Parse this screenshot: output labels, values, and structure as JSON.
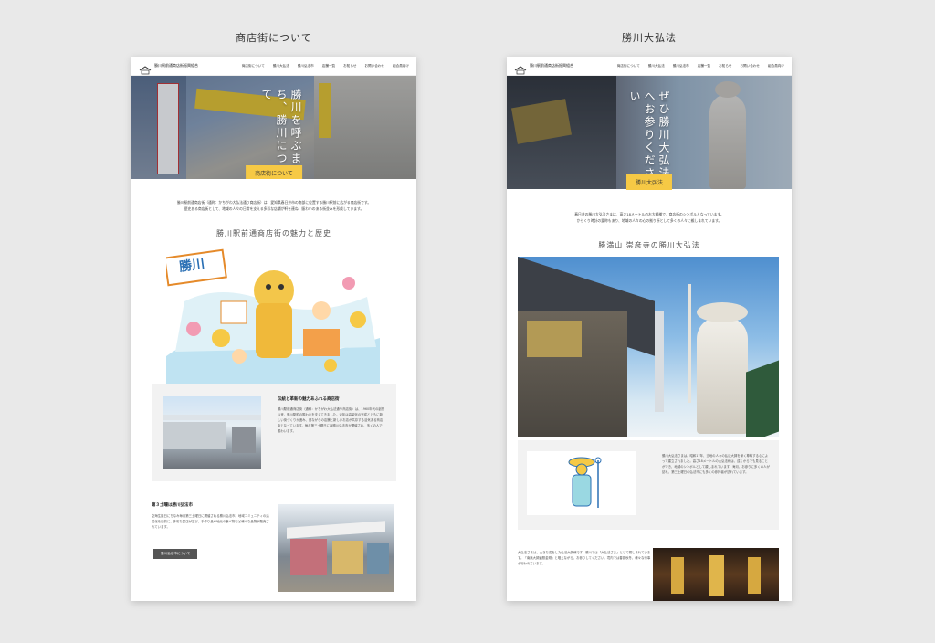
{
  "panels": {
    "left_title": "商店街について",
    "right_title": "勝川大弘法"
  },
  "left": {
    "header": {
      "logo_text": "勝川駅前通商店街振興組合",
      "nav": [
        "商店街について",
        "勝川大弘法",
        "勝川弘法市",
        "店舗一覧",
        "お知らせ",
        "お問い合わせ",
        "組合員向け"
      ]
    },
    "hero": {
      "vertical_text": "勝川を呼ぶまち、勝川について",
      "label": "商店街について",
      "sign_text": "勝川"
    },
    "intro": [
      "勝川駅前通商店街（通称：かちがわ大弘法通り商店街）は、愛知県春日井市の南部に位置する勝川駅前に広がる商店街です。",
      "歴史ある商店街として、地域の人々の日常を支える多彩な店舗が軒を連ね、賑わいのある街並みを形成しています。"
    ],
    "section_title": "勝川駅前通商店街の魅力と歴史",
    "illustration_sign": "勝川",
    "card1": {
      "heading": "伝統と革新の魅力あふれる商店街",
      "body": "勝川駅前通商店街（通称：かちがわ大弘法通り商店街）は、1960年代の創業以来、勝川駅前の賑わいを支えてきました。近年は高架化の完成とともに新しい街づくりが進み、昔ながらの店舗と新しいお店が共存する活気ある商店街となっています。毎月第三土曜日には勝川弘法市が開催され、多くの人で賑わいます。"
    },
    "card2": {
      "heading": "第３土曜は勝川弘法市",
      "body": "空海生誕日にちなみ毎月第三土曜日に開催される勝川弘法市。地域コミュニティの活性化を目的に、多彩な露店が並び、手作り品や地元の食べ物など様々な品物が販売されています。",
      "button": "勝川弘法市について"
    }
  },
  "right": {
    "header": {
      "logo_text": "勝川駅前通商店街振興組合",
      "nav": [
        "商店街について",
        "勝川大弘法",
        "勝川弘法市",
        "店舗一覧",
        "お知らせ",
        "お問い合わせ",
        "組合員向け"
      ]
    },
    "hero": {
      "vertical_text": "ぜひ勝川大弘法へお参りください",
      "label": "勝川大弘法"
    },
    "intro": [
      "春日井の勝川大弘法さまは、高さ18メートルのお大師様で、商店街のシンボルとなっています。",
      "からくり時計の愛称もあり、地域の人々の心の拠り所として多くの人々に親しまれています。"
    ],
    "section_title": "勝満山 崇彦寺の勝川大弘法",
    "card": {
      "body": "勝川大弘法さまは、昭和17年、当地の人々の弘法大師を深く尊敬する心によって建立されました。高さ18メートルの大弘法様は、遠くからでも見ることができ、地域のシンボルとして親しまれています。毎月、お参りに多くの人が訪れ、第三土曜日の弘法市にも多くの参拝者が訪れています。"
    },
    "bottom_text": "大弘法さまは、大きな姿をした弘法大師様です。勝川では「大弘法さま」として親しまれています。「南無大師遍照金剛」と唱えながら、お参りしてください。境内では春夏秋冬、様々な行事が行われています。"
  }
}
